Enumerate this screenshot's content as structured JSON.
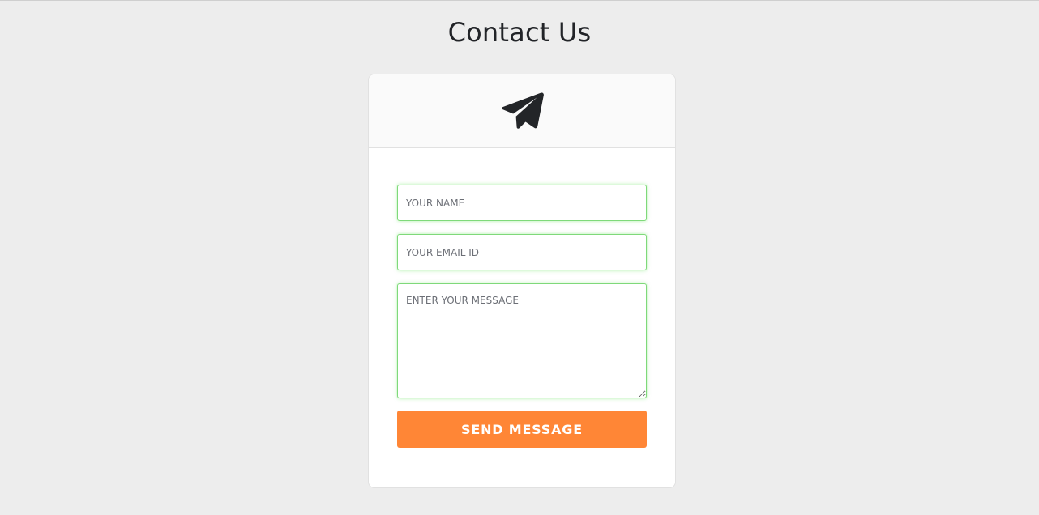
{
  "page": {
    "title": "Contact Us"
  },
  "card": {
    "header_icon": "paper-plane-icon"
  },
  "form": {
    "name_placeholder": "YOUR NAME",
    "name_value": "",
    "email_placeholder": "YOUR EMAIL ID",
    "email_value": "",
    "message_placeholder": "ENTER YOUR MESSAGE",
    "message_value": "",
    "submit_label": "SEND MESSAGE"
  },
  "colors": {
    "background": "#ededed",
    "card": "#ffffff",
    "card_header": "#fafafa",
    "field_border": "#7fd97a",
    "button": "#ff8636",
    "title_text": "#222428"
  }
}
